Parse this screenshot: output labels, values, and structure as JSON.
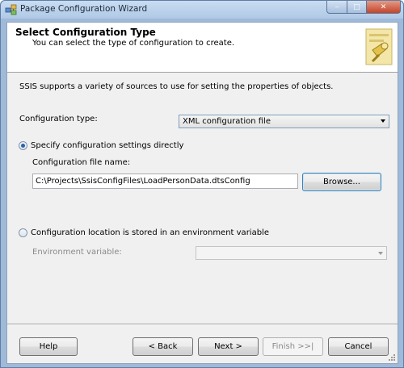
{
  "window": {
    "title": "Package Configuration Wizard",
    "app_icon": "package-icon",
    "controls": {
      "minimize": "–",
      "maximize": "□",
      "close": "✕"
    }
  },
  "header": {
    "title": "Select Configuration Type",
    "subtitle": "You can select the type of configuration to create.",
    "image_icon": "configuration-wizard-icon"
  },
  "description": "SSIS supports a variety of sources to use for setting the properties of objects.",
  "config_type": {
    "label": "Configuration type:",
    "selected": "XML configuration file"
  },
  "options": {
    "direct": {
      "label": "Specify configuration settings directly",
      "checked": true
    },
    "env": {
      "label": "Configuration location is stored in an environment variable",
      "checked": false
    }
  },
  "file_name": {
    "label": "Configuration file name:",
    "value": "C:\\Projects\\SsisConfigFiles\\LoadPersonData.dtsConfig",
    "browse_label": "Browse..."
  },
  "env_variable": {
    "label": "Environment variable:",
    "value": ""
  },
  "footer": {
    "help": "Help",
    "back": "< Back",
    "next": "Next >",
    "finish": "Finish >>|",
    "cancel": "Cancel"
  },
  "colors": {
    "accent": "#2c62a8",
    "frame": "#9fb9d9",
    "close_button": "#c4432a"
  }
}
